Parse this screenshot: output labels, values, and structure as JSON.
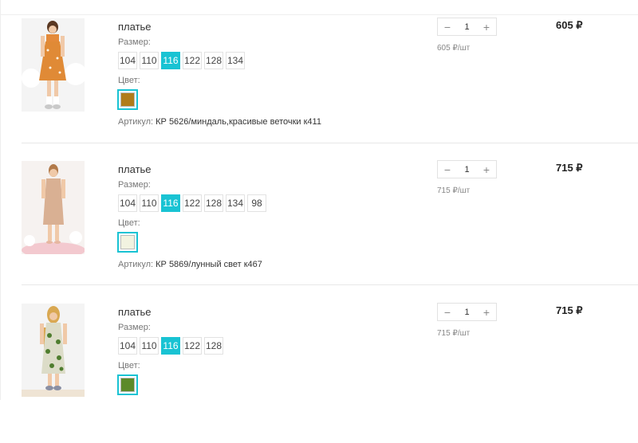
{
  "colors": {
    "accent": "#19c3d3"
  },
  "icons": {
    "minus": "minus-icon",
    "plus": "plus-icon"
  },
  "items": [
    {
      "title": "платье",
      "size_label": "Размер:",
      "sizes": [
        "104",
        "110",
        "116",
        "122",
        "128",
        "134"
      ],
      "selected_size": "116",
      "color_label": "Цвет:",
      "color_swatch": "#b07c1a",
      "sku_label": "Артикул:",
      "sku_value": "КР 5626/миндаль,красивые веточки к411",
      "qty": "1",
      "unit_price": "605 ₽/шт",
      "total": "605 ₽",
      "photo": "girl-orange-dress"
    },
    {
      "title": "платье",
      "size_label": "Размер:",
      "sizes": [
        "104",
        "110",
        "116",
        "122",
        "128",
        "134",
        "98"
      ],
      "selected_size": "116",
      "color_label": "Цвет:",
      "color_swatch": "#f2f3e0",
      "sku_label": "Артикул:",
      "sku_value": "КР 5869/лунный свет к467",
      "qty": "1",
      "unit_price": "715 ₽/шт",
      "total": "715 ₽",
      "photo": "girl-beige-dress"
    },
    {
      "title": "платье",
      "size_label": "Размер:",
      "sizes": [
        "104",
        "110",
        "116",
        "122",
        "128"
      ],
      "selected_size": "116",
      "color_label": "Цвет:",
      "color_swatch": "#5c8a2a",
      "qty": "1",
      "unit_price": "715 ₽/шт",
      "total": "715 ₽",
      "photo": "girl-green-dress"
    }
  ]
}
